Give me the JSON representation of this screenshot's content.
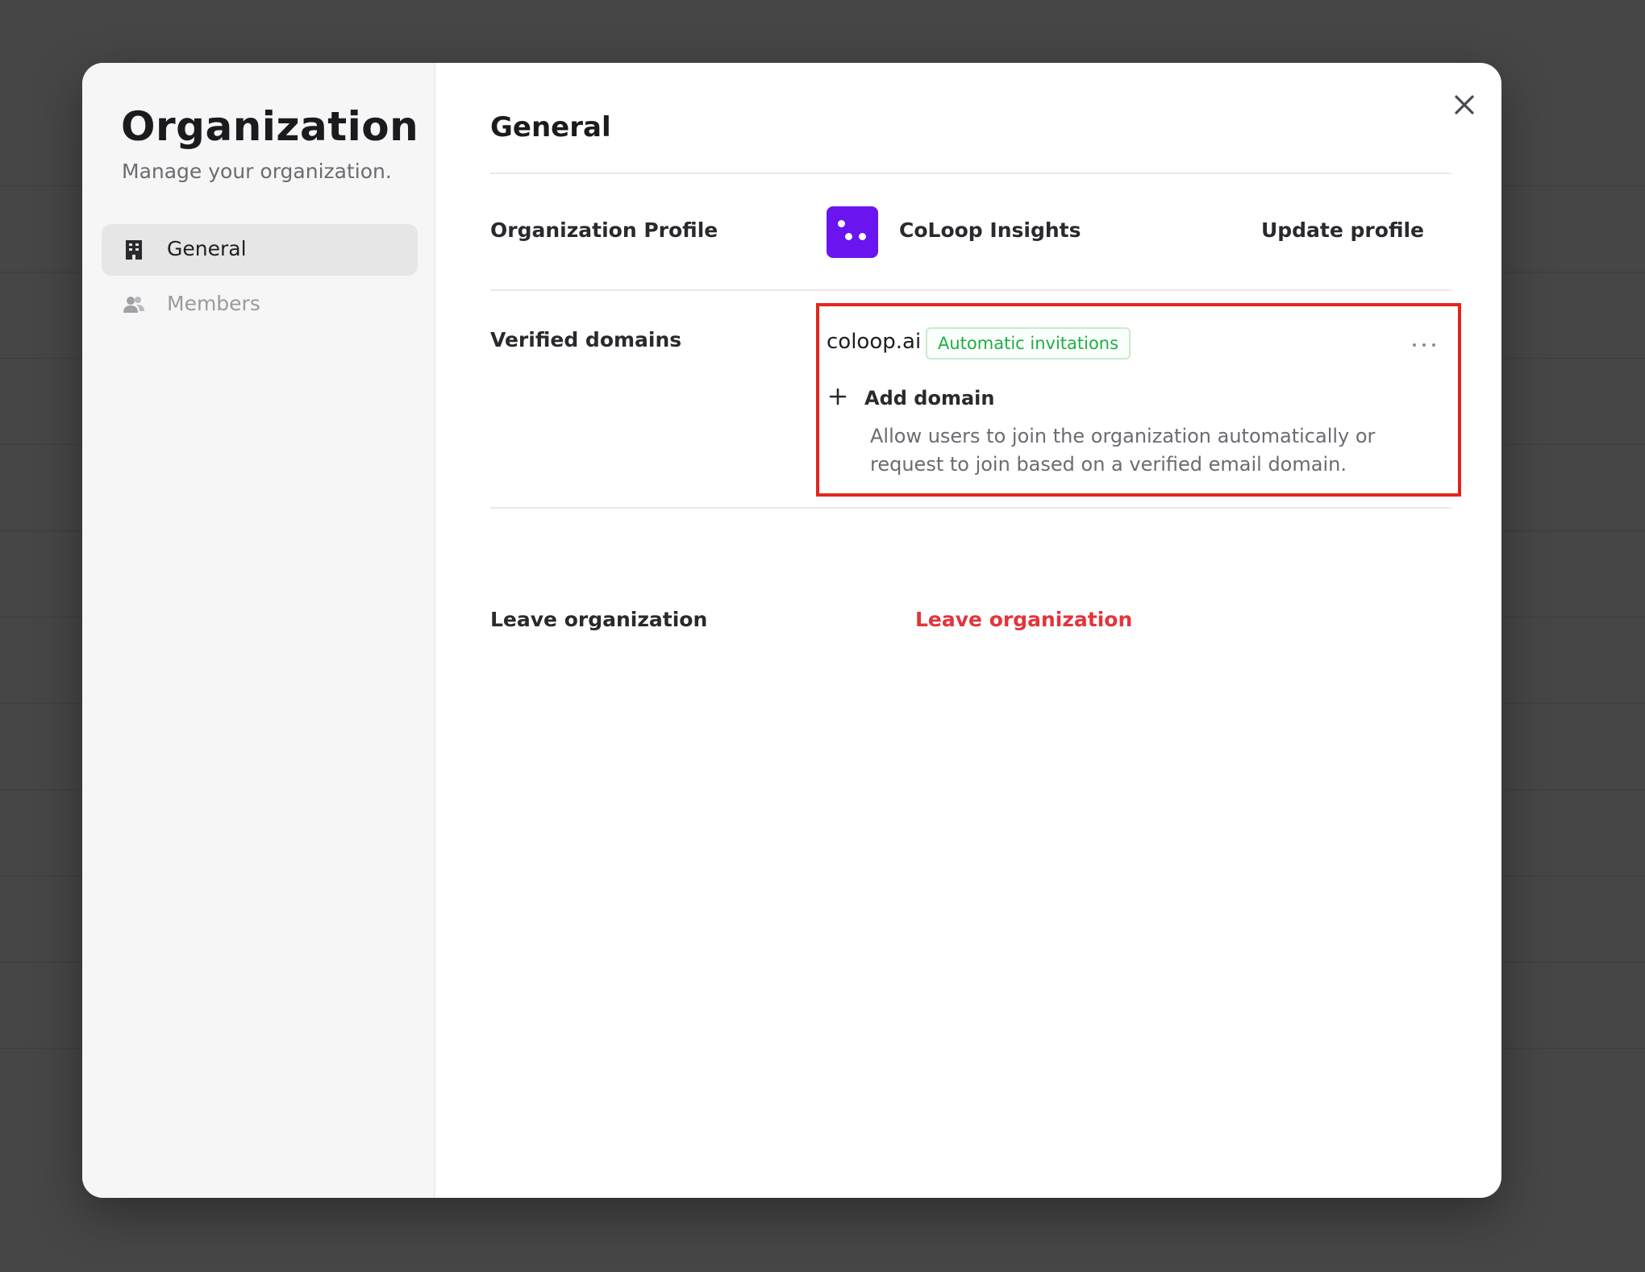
{
  "sidebar": {
    "title": "Organization",
    "subtitle": "Manage your organization.",
    "items": [
      {
        "label": "General",
        "icon": "building-icon",
        "active": true
      },
      {
        "label": "Members",
        "icon": "users-icon",
        "active": false
      }
    ]
  },
  "main": {
    "section_title": "General",
    "close_icon": "close-icon",
    "profile": {
      "label": "Organization Profile",
      "org_name": "CoLoop Insights",
      "logo_color": "#6a14ef",
      "update_label": "Update profile"
    },
    "domains": {
      "label": "Verified domains",
      "items": [
        {
          "domain": "coloop.ai",
          "badge": "Automatic invitations"
        }
      ],
      "add_label": "Add domain",
      "help_text": "Allow users to join the organization automatically or request to join based on a verified email domain."
    },
    "leave": {
      "label": "Leave organization",
      "action_label": "Leave organization",
      "action_color": "#e5343c"
    }
  },
  "highlight_color": "#e3251c"
}
